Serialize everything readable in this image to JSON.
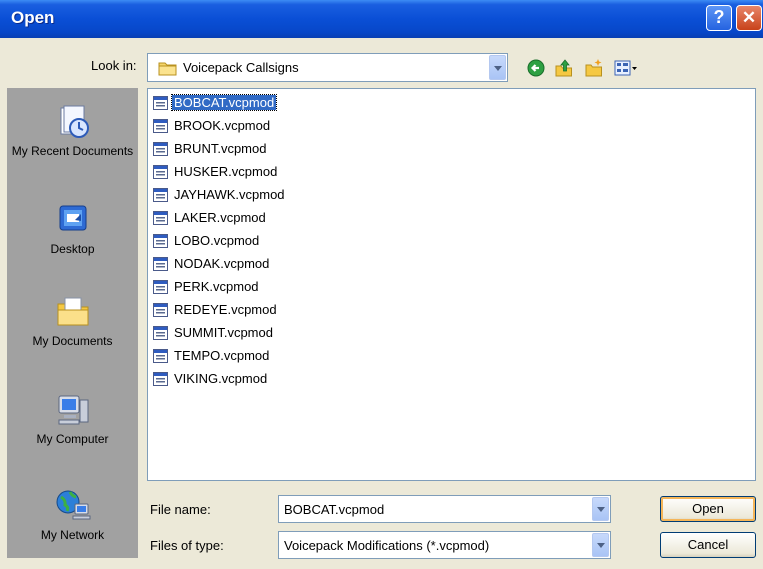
{
  "window": {
    "title": "Open"
  },
  "titlebar": {
    "help_label": "?",
    "close_label": "✕"
  },
  "lookin": {
    "label": "Look in:",
    "value": "Voicepack Callsigns"
  },
  "toolbar": {
    "back": "back-icon",
    "up": "up-folder-icon",
    "new_folder": "new-folder-icon",
    "views": "views-menu-icon"
  },
  "places": [
    {
      "label": "My Recent Documents",
      "icon": "recent-documents-icon"
    },
    {
      "label": "Desktop",
      "icon": "desktop-icon"
    },
    {
      "label": "My Documents",
      "icon": "my-documents-icon"
    },
    {
      "label": "My Computer",
      "icon": "my-computer-icon"
    },
    {
      "label": "My Network",
      "icon": "my-network-icon"
    }
  ],
  "files": [
    "BOBCAT.vcpmod",
    "BROOK.vcpmod",
    "BRUNT.vcpmod",
    "HUSKER.vcpmod",
    "JAYHAWK.vcpmod",
    "LAKER.vcpmod",
    "LOBO.vcpmod",
    "NODAK.vcpmod",
    "PERK.vcpmod",
    "REDEYE.vcpmod",
    "SUMMIT.vcpmod",
    "TEMPO.vcpmod",
    "VIKING.vcpmod"
  ],
  "selected_file": "BOBCAT.vcpmod",
  "filename": {
    "label": "File name:",
    "value": "BOBCAT.vcpmod"
  },
  "filetype": {
    "label": "Files of type:",
    "value": "Voicepack Modifications (*.vcpmod)"
  },
  "buttons": {
    "open": "Open",
    "cancel": "Cancel"
  },
  "colors": {
    "titlebar": "#0a4fd6",
    "selection": "#316ac5",
    "dialog_bg": "#ece9d8"
  }
}
